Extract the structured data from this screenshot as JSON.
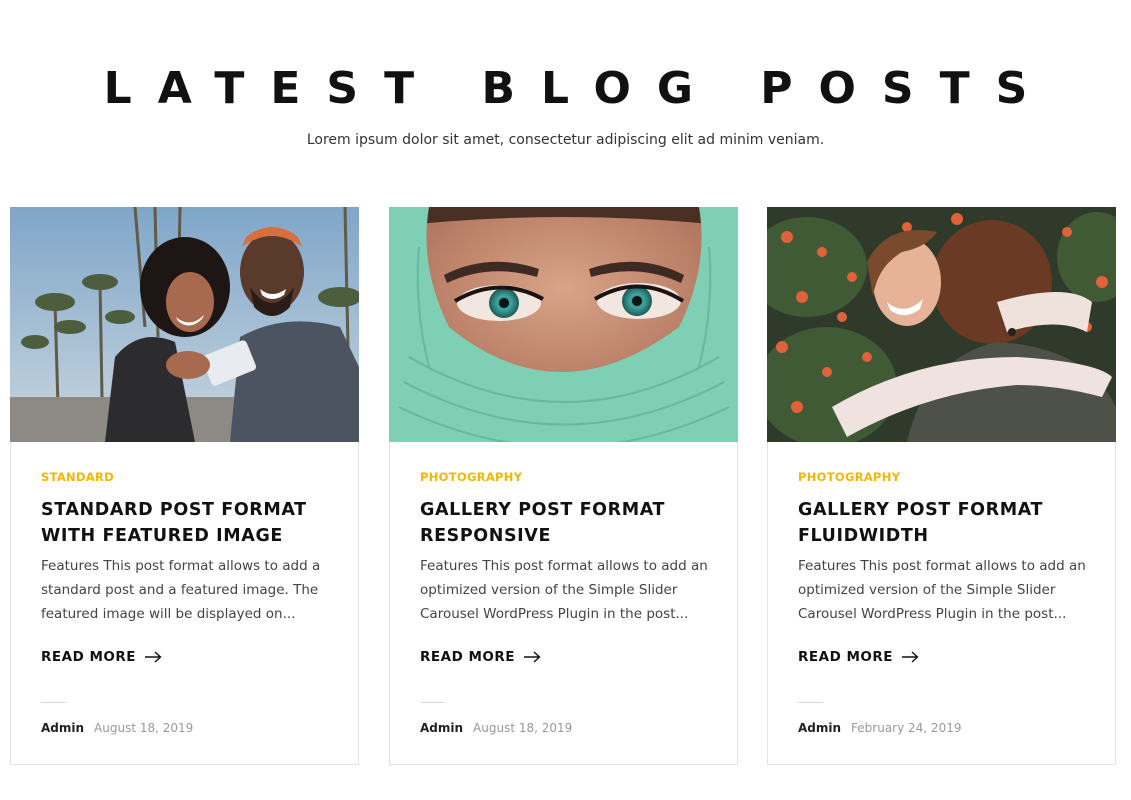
{
  "section": {
    "title": "LATEST BLOG POSTS",
    "subtitle": "Lorem ipsum dolor sit amet, consectetur adipiscing elit ad minim veniam."
  },
  "posts": [
    {
      "category": "STANDARD",
      "title": "STANDARD POST FORMAT WITH FEATURED IMAGE",
      "excerpt": "Features This post format allows to add a standard post and a featured image. The featured image will be displayed on...",
      "read_more": "READ MORE",
      "author": "Admin",
      "date": "August 18, 2019",
      "image_icon": "couple-selfie-photo"
    },
    {
      "category": "PHOTOGRAPHY",
      "title": "GALLERY POST FORMAT RESPONSIVE",
      "excerpt": "Features This post format allows to add an optimized version of the Simple Slider Carousel WordPress Plugin in the post...",
      "read_more": "READ MORE",
      "author": "Admin",
      "date": "August 18, 2019",
      "image_icon": "woman-eyes-green-scarf-photo"
    },
    {
      "category": "PHOTOGRAPHY",
      "title": "GALLERY POST FORMAT FLUIDWIDTH",
      "excerpt": "Features This post format allows to add an optimized version of the Simple Slider Carousel WordPress Plugin in the post...",
      "read_more": "READ MORE",
      "author": "Admin",
      "date": "February 24, 2019",
      "image_icon": "friends-hugging-photo"
    }
  ],
  "colors": {
    "accent": "#f2b705",
    "heading": "#111111",
    "body_text": "#444444",
    "meta_text": "#999999",
    "border": "#e3e3e3"
  }
}
